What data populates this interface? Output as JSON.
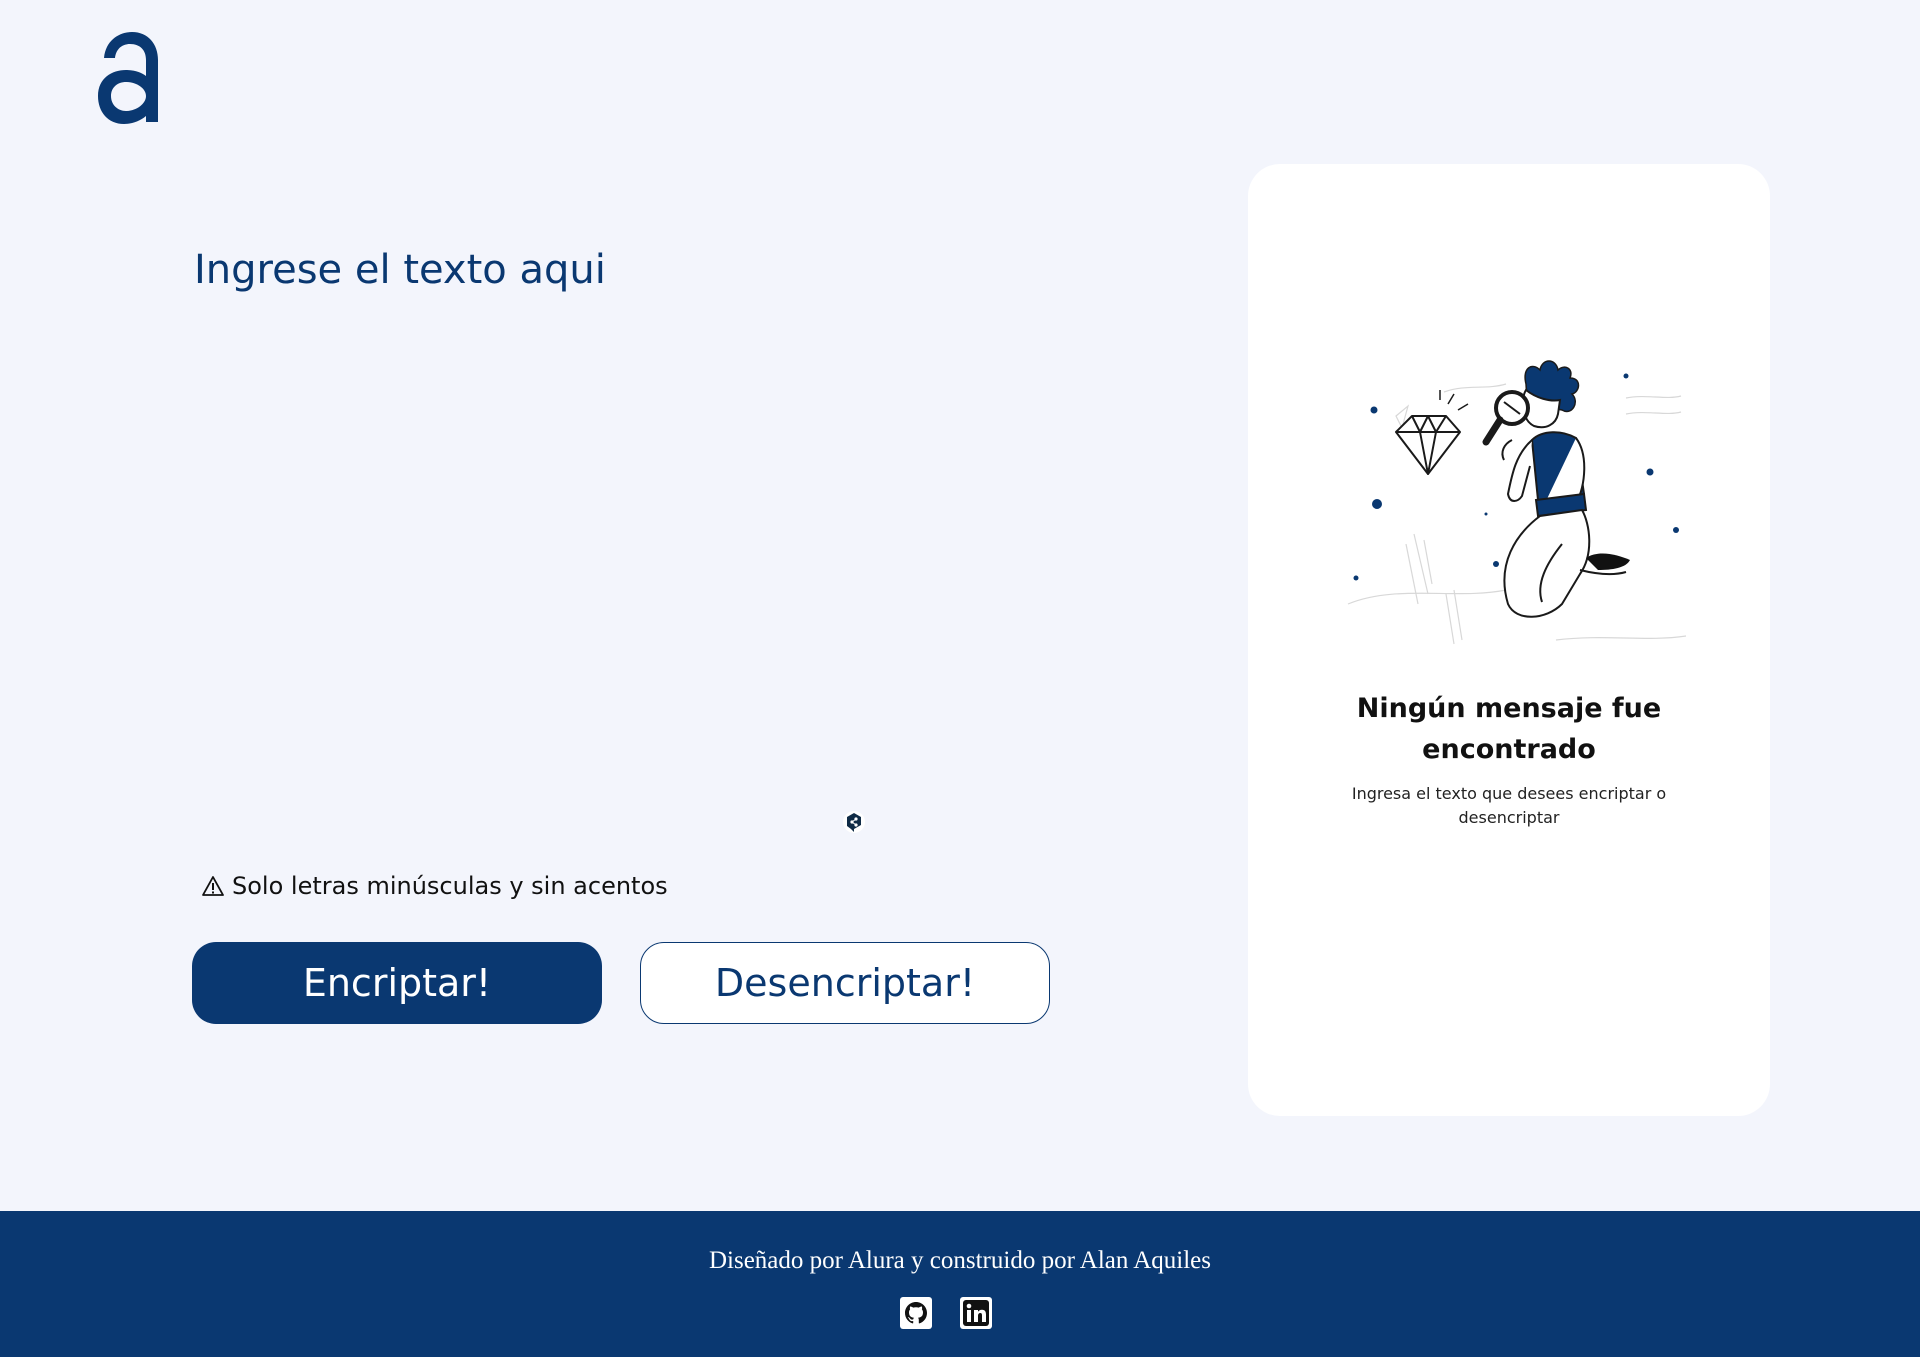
{
  "brand": {
    "logo_icon": "alura-a-logo",
    "primary_color": "#0A3871",
    "background_color": "#F3F5FC"
  },
  "editor": {
    "placeholder": "Ingrese el texto aqui",
    "value": "",
    "grammar_extension_icon": "deepl-icon"
  },
  "hint": {
    "icon": "warning-icon",
    "text": "Solo letras minúsculas y sin acentos"
  },
  "actions": {
    "encrypt_label": "Encriptar!",
    "decrypt_label": "Desencriptar!"
  },
  "output": {
    "illustration": "person-with-magnifying-glass-diamond",
    "empty_title": "Ningún mensaje fue encontrado",
    "empty_description": "Ingresa el texto que desees encriptar o desencriptar"
  },
  "footer": {
    "credit": "Diseñado por Alura y construido por Alan Aquiles",
    "links": [
      {
        "icon": "github-icon"
      },
      {
        "icon": "linkedin-icon"
      }
    ]
  }
}
